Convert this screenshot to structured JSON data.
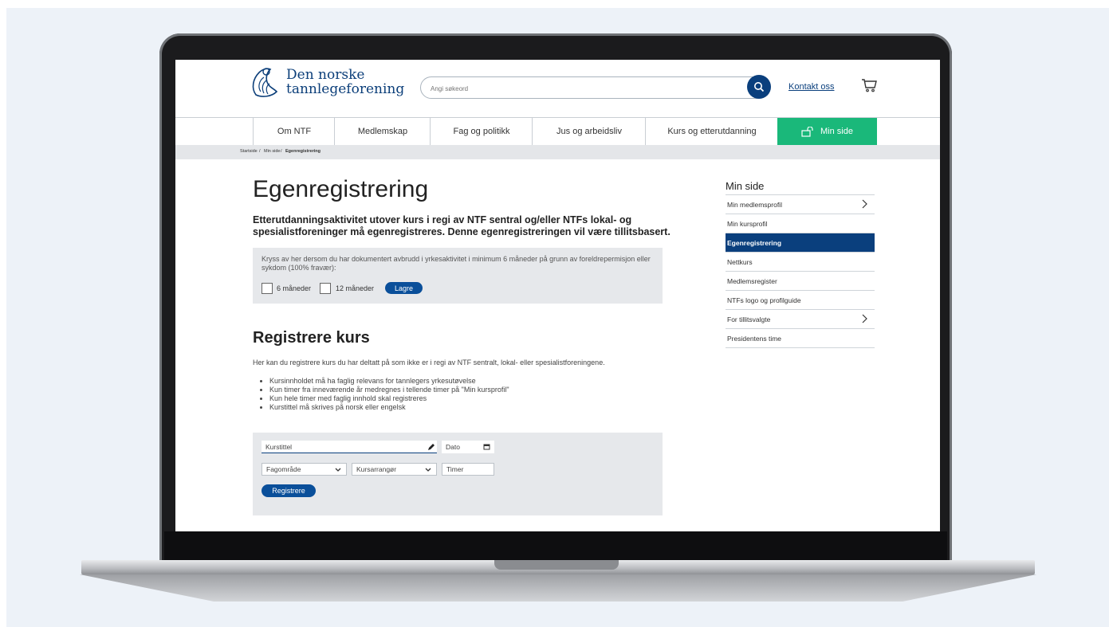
{
  "header": {
    "logo_line1": "Den norske",
    "logo_line2": "tannlegeforening",
    "search_placeholder": "Angi søkeord",
    "contact_label": "Kontakt oss"
  },
  "nav": {
    "items": [
      {
        "label": "Om NTF"
      },
      {
        "label": "Medlemskap"
      },
      {
        "label": "Fag og politikk"
      },
      {
        "label": "Jus og arbeidsliv"
      },
      {
        "label": "Kurs og etterutdanning"
      },
      {
        "label": "Min side"
      }
    ]
  },
  "breadcrumb": {
    "items": [
      "Startside",
      "Min side",
      "Egenregistrering"
    ],
    "separator": "/"
  },
  "main": {
    "title": "Egenregistrering",
    "intro": "Etterutdanningsaktivitet utover kurs i regi av NTF sentral og/eller NTFs lokal- og spesialistforeninger må egenregistreres. Denne egenregistreringen vil være tillitsbasert.",
    "absence": {
      "text": "Kryss av her dersom du har dokumentert avbrudd i yrkesaktivitet i minimum 6 måneder på grunn av foreldrepermisjon eller sykdom (100% fravær):",
      "option1": "6 måneder",
      "option2": "12 måneder",
      "save_label": "Lagre"
    },
    "course_heading": "Registrere kurs",
    "course_desc": "Her kan du registrere kurs du har deltatt på som ikke er i regi av NTF sentralt, lokal- eller spesialistforeningene.",
    "bullets": [
      "Kursinnholdet må ha faglig relevans for tannlegers yrkesutøvelse",
      "Kun timer fra inneværende år medregnes i tellende timer på \"Min kursprofil\"",
      "Kun hele timer med faglig innhold skal registreres",
      "Kurstittel må skrives på norsk eller engelsk"
    ],
    "form": {
      "title_placeholder": "Kurstittel",
      "date_placeholder": "Dato",
      "field_placeholder": "Fagområde",
      "organizer_placeholder": "Kursarrangør",
      "hours_placeholder": "Timer",
      "submit_label": "Registrere"
    }
  },
  "sidebar": {
    "title": "Min side",
    "items": [
      {
        "label": "Min medlemsprofil",
        "has_chevron": true
      },
      {
        "label": "Min kursprofil"
      },
      {
        "label": "Egenregistrering",
        "active": true
      },
      {
        "label": "Nettkurs"
      },
      {
        "label": "Medlemsregister"
      },
      {
        "label": "NTFs logo og profilguide"
      },
      {
        "label": "For tillitsvalgte",
        "has_chevron": true
      },
      {
        "label": "Presidentens time"
      }
    ]
  },
  "colors": {
    "brand_navy": "#0a3f7d",
    "active_green": "#1ab87a",
    "button_blue": "#0a4f9a",
    "panel_grey": "#e6e8eb",
    "backdrop": "#edf2f8"
  },
  "icons": [
    "logo-emblem",
    "search-icon",
    "cart-icon",
    "lock-icon",
    "pencil-icon",
    "calendar-icon",
    "chevron-down-icon",
    "chevron-right-icon"
  ]
}
